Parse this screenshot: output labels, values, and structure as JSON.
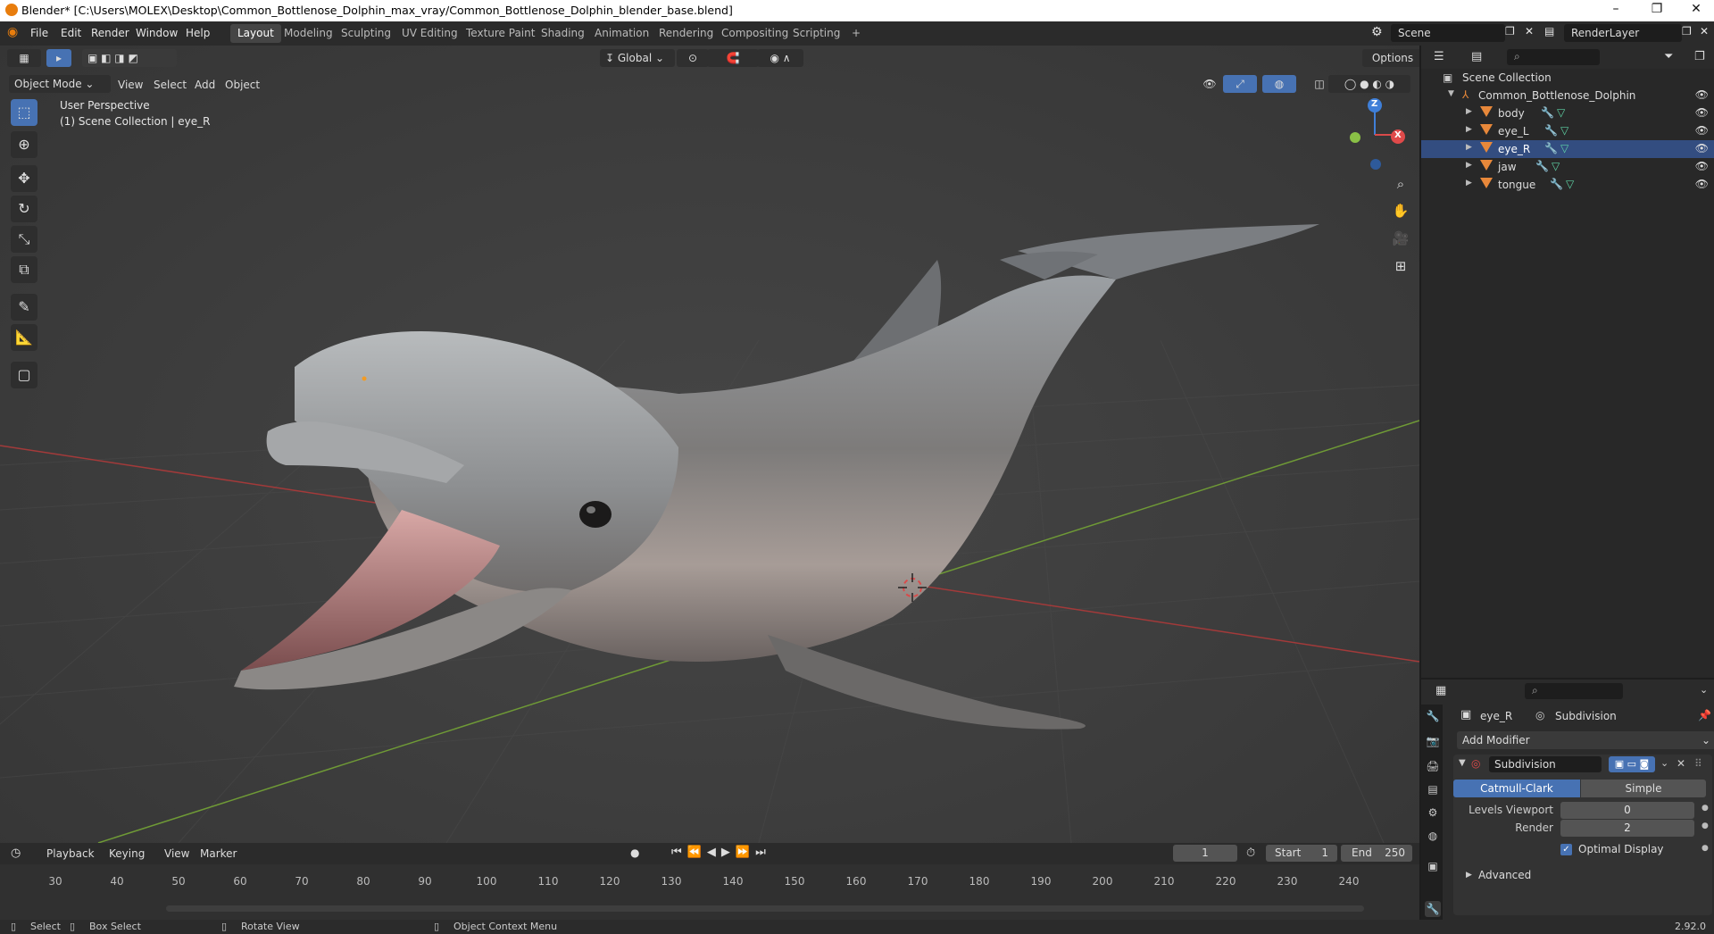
{
  "window": {
    "title": "Blender* [C:\\Users\\MOLEX\\Desktop\\Common_Bottlenose_Dolphin_max_vray/Common_Bottlenose_Dolphin_blender_base.blend]",
    "minimize": "–",
    "maximize": "❐",
    "close": "✕"
  },
  "menu": [
    "File",
    "Edit",
    "Render",
    "Window",
    "Help"
  ],
  "workspaces": [
    "Layout",
    "Modeling",
    "Sculpting",
    "UV Editing",
    "Texture Paint",
    "Shading",
    "Animation",
    "Rendering",
    "Compositing",
    "Scripting",
    "+"
  ],
  "active_workspace": "Layout",
  "scene": {
    "name": "Scene",
    "render_layer": "RenderLayer"
  },
  "viewport": {
    "mode": "Object Mode",
    "menus": [
      "View",
      "Select",
      "Add",
      "Object"
    ],
    "transform_orientation": "Global",
    "options_label": "Options",
    "overlay_line1": "User Perspective",
    "overlay_line2": "(1) Scene Collection | eye_R",
    "gizmo_z": "Z",
    "gizmo_x": "X"
  },
  "outliner": {
    "root": "Scene Collection",
    "collection": "Common_Bottlenose_Dolphin",
    "objects": [
      "body",
      "eye_L",
      "eye_R",
      "jaw",
      "tongue"
    ],
    "selected": "eye_R"
  },
  "properties": {
    "object": "eye_R",
    "modifier_name": "Subdivision",
    "add_modifier": "Add Modifier",
    "tab_catmull": "Catmull-Clark",
    "tab_simple": "Simple",
    "levels_viewport_label": "Levels Viewport",
    "levels_viewport_value": "0",
    "render_label": "Render",
    "render_value": "2",
    "optimal_display": "Optimal Display",
    "advanced": "Advanced"
  },
  "timeline": {
    "menus": [
      "Playback",
      "Keying",
      "View",
      "Marker"
    ],
    "current_frame": "1",
    "start_label": "Start",
    "start_value": "1",
    "end_label": "End",
    "end_value": "250",
    "ticks": [
      "30",
      "40",
      "50",
      "60",
      "70",
      "80",
      "90",
      "100",
      "110",
      "120",
      "130",
      "140",
      "150",
      "160",
      "170",
      "180",
      "190",
      "200",
      "210",
      "220",
      "230",
      "240"
    ]
  },
  "statusbar": {
    "select": "Select",
    "box_select": "Box Select",
    "rotate_view": "Rotate View",
    "context_menu": "Object Context Menu",
    "version": "2.92.0"
  },
  "colors": {
    "accent": "#4772b3",
    "object_orange": "#e8883a",
    "x_axis": "#e04a4a",
    "y_axis": "#8ac046",
    "z_axis": "#3f7fd8"
  }
}
